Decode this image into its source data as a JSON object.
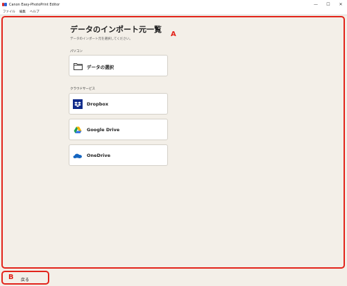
{
  "window": {
    "title": "Canon Easy-PhotoPrint Editor",
    "minimize": "—",
    "maximize": "☐",
    "close": "✕"
  },
  "menu": {
    "items": [
      "ファイル",
      "編集",
      "ヘルプ"
    ]
  },
  "main": {
    "title": "データのインポート元一覧",
    "subtitle": "データのインポート元を選択してください。",
    "sections": {
      "pc": {
        "label": "パソコン",
        "buttons": [
          {
            "label": "データの選択",
            "icon": "folder-icon"
          }
        ]
      },
      "cloud": {
        "label": "クラウドサービス",
        "buttons": [
          {
            "label": "Dropbox",
            "icon": "dropbox-icon"
          },
          {
            "label": "Google Drive",
            "icon": "google-drive-icon"
          },
          {
            "label": "OneDrive",
            "icon": "onedrive-icon"
          }
        ]
      }
    }
  },
  "footer": {
    "back_label": "戻る"
  },
  "annotations": {
    "a": "A",
    "b": "B"
  },
  "colors": {
    "background": "#f3efe8",
    "annotation_red": "#e2231a",
    "dropbox_blue": "#0f2a8a",
    "onedrive_blue": "#1565c0"
  }
}
